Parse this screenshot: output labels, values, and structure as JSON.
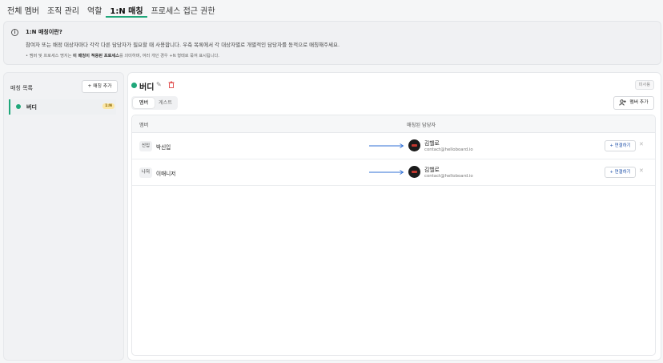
{
  "tabs": [
    "전체 멤버",
    "조직 관리",
    "역할",
    "1:N 매칭",
    "프로세스 접근 권한"
  ],
  "active_tab_index": 3,
  "info": {
    "icon": "info-icon",
    "title": "1:N 매칭이란?",
    "desc": "참여자 또는 배정 대상자마다 각각 다른 담당자가 필요할 때 사용합니다. 우측 목록에서 각 대상자별로 개별적인 담당자를 동적으로 매칭해주세요.",
    "note_pre": "• 멤버 및 프로세스 명지는 ",
    "note_bold": "이 매칭이 적용된 프로세스",
    "note_post": "를 의미하며, 여러 개인 경우 +N 형태로 묶여 표시됩니다."
  },
  "left": {
    "title": "매칭 목록",
    "add_button": "+ 매칭 추가",
    "items": [
      {
        "label": "버디",
        "badge": "1:N",
        "color": "#1fa77a"
      }
    ]
  },
  "right": {
    "title": "버디",
    "status_tag": "미사용",
    "segments": [
      "멤버",
      "게스트"
    ],
    "active_segment": 0,
    "add_member": "멤버 추가",
    "columns": {
      "member": "멤버",
      "manager": "매칭된 담당자"
    },
    "rows": [
      {
        "role": "신입",
        "name": "박신입",
        "manager_name": "김헬로",
        "manager_email": "contact@helloboard.io",
        "connect": "+ 연결하기"
      },
      {
        "role": "나저",
        "name": "이매니저",
        "manager_name": "김헬로",
        "manager_email": "contact@helloboard.io",
        "connect": "+ 연결하기"
      }
    ]
  },
  "colors": {
    "accent": "#1fa77a",
    "link": "#1d4fa8",
    "arrow": "#2f6fd6",
    "delete": "#e25555"
  }
}
